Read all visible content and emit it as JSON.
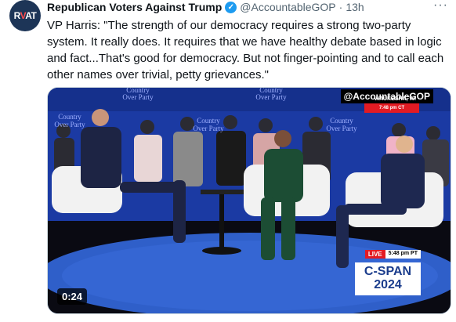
{
  "post": {
    "avatar": {
      "text_left": "R",
      "text_mid": "V",
      "text_right": "AT",
      "bg": "#1d3557",
      "accent": "#ff4d4d"
    },
    "author_name": "Republican Voters Against Trump",
    "verified_icon": "verified-badge-icon",
    "handle": "@AccountableGOP",
    "separator": "·",
    "time": "13h",
    "more_icon": "more-horizontal-icon",
    "more_glyph": "···",
    "text": "VP Harris: \"The strength of our democracy requires a strong two-party system. It really does. It requires that we have healthy debate based in logic and fact...That's good for democracy. But not finger-pointing and to call each other names over trivial, petty grievances.\""
  },
  "video": {
    "backdrop_text": "Country Over Party",
    "backdrop_repeat": [
      "Country",
      "Over Party"
    ],
    "watermark": "@AccountableGOP",
    "news_location": "WAUKESHA, WI",
    "news_time": "7:48 pm CT",
    "live_label": "LIVE",
    "live_time": "5:48 pm PT",
    "network_logo_line1": "C-SPAN",
    "network_logo_line2": "2024",
    "duration": "0:24",
    "colors": {
      "backdrop": "#1b3aa3",
      "stage": "#2f5fc9",
      "chair": "#f2f2f2",
      "live_red": "#e31b23"
    }
  }
}
